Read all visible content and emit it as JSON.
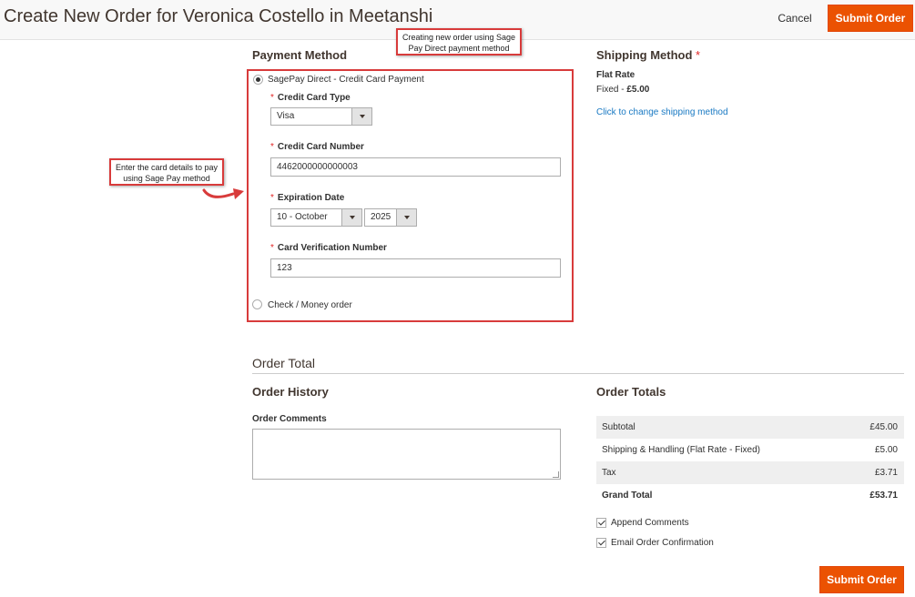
{
  "header": {
    "title": "Create New Order for Veronica Costello in Meetanshi",
    "cancel_label": "Cancel",
    "submit_label": "Submit Order"
  },
  "annotations": {
    "top": "Creating new order using Sage Pay Direct payment method",
    "left": "Enter the card details to pay using Sage Pay method"
  },
  "payment": {
    "title": "Payment Method",
    "options": [
      {
        "label": "SagePay Direct - Credit Card Payment",
        "checked": true
      },
      {
        "label": "Check / Money order",
        "checked": false
      }
    ],
    "fields": {
      "cc_type": {
        "label": "Credit Card Type",
        "value": "Visa"
      },
      "cc_number": {
        "label": "Credit Card Number",
        "value": "4462000000000003"
      },
      "exp_date": {
        "label": "Expiration Date",
        "month": "10 - October",
        "year": "2025"
      },
      "cvv": {
        "label": "Card Verification Number",
        "value": "123"
      }
    },
    "required_mark": "*"
  },
  "shipping": {
    "title": "Shipping Method",
    "required_mark": "*",
    "carrier": "Flat Rate",
    "method": "Fixed - ",
    "price": "£5.00",
    "change_link": "Click to change shipping method"
  },
  "order_total": {
    "title": "Order Total",
    "history_title": "Order History",
    "comments_label": "Order Comments",
    "totals_title": "Order Totals",
    "rows": [
      {
        "label": "Subtotal",
        "value": "£45.00"
      },
      {
        "label": "Shipping & Handling (Flat Rate - Fixed)",
        "value": "£5.00"
      },
      {
        "label": "Tax",
        "value": "£3.71"
      },
      {
        "label": "Grand Total",
        "value": "£53.71"
      }
    ],
    "append_comments": "Append Comments",
    "email_confirmation": "Email Order Confirmation",
    "submit_label": "Submit Order"
  },
  "colors": {
    "accent": "#eb5202",
    "annotation_border": "#d83b3b",
    "link": "#1979c3"
  }
}
